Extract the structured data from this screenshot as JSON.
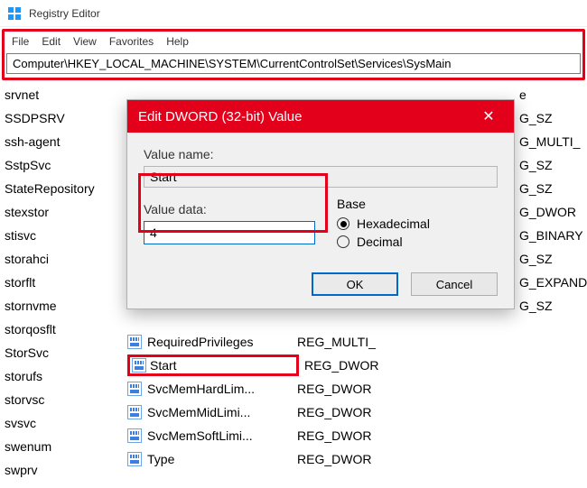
{
  "app": {
    "title": "Registry Editor"
  },
  "menu": {
    "file": "File",
    "edit": "Edit",
    "view": "View",
    "favorites": "Favorites",
    "help": "Help"
  },
  "address": "Computer\\HKEY_LOCAL_MACHINE\\SYSTEM\\CurrentControlSet\\Services\\SysMain",
  "tree": [
    "srvnet",
    "SSDPSRV",
    "ssh-agent",
    "SstpSvc",
    "StateRepository",
    "stexstor",
    "stisvc",
    "storahci",
    "storflt",
    "stornvme",
    "storqosflt",
    "StorSvc",
    "storufs",
    "storvsc",
    "svsvc",
    "swenum",
    "swprv"
  ],
  "types_partial": [
    "e",
    "G_SZ",
    "G_MULTI_",
    "G_SZ",
    "G_SZ",
    "G_DWOR",
    "G_BINARY",
    "G_SZ",
    "G_EXPAND",
    "G_SZ"
  ],
  "list": [
    {
      "name": "RequiredPrivileges",
      "type": "REG_MULTI_"
    },
    {
      "name": "Start",
      "type": "REG_DWOR"
    },
    {
      "name": "SvcMemHardLim...",
      "type": "REG_DWOR"
    },
    {
      "name": "SvcMemMidLimi...",
      "type": "REG_DWOR"
    },
    {
      "name": "SvcMemSoftLimi...",
      "type": "REG_DWOR"
    },
    {
      "name": "Type",
      "type": "REG_DWOR"
    }
  ],
  "dialog": {
    "title": "Edit DWORD (32-bit) Value",
    "value_name_label": "Value name:",
    "value_name": "Start",
    "value_data_label": "Value data:",
    "value_data": "4",
    "base_label": "Base",
    "hex": "Hexadecimal",
    "dec": "Decimal",
    "selected_base": "hex",
    "ok": "OK",
    "cancel": "Cancel"
  }
}
